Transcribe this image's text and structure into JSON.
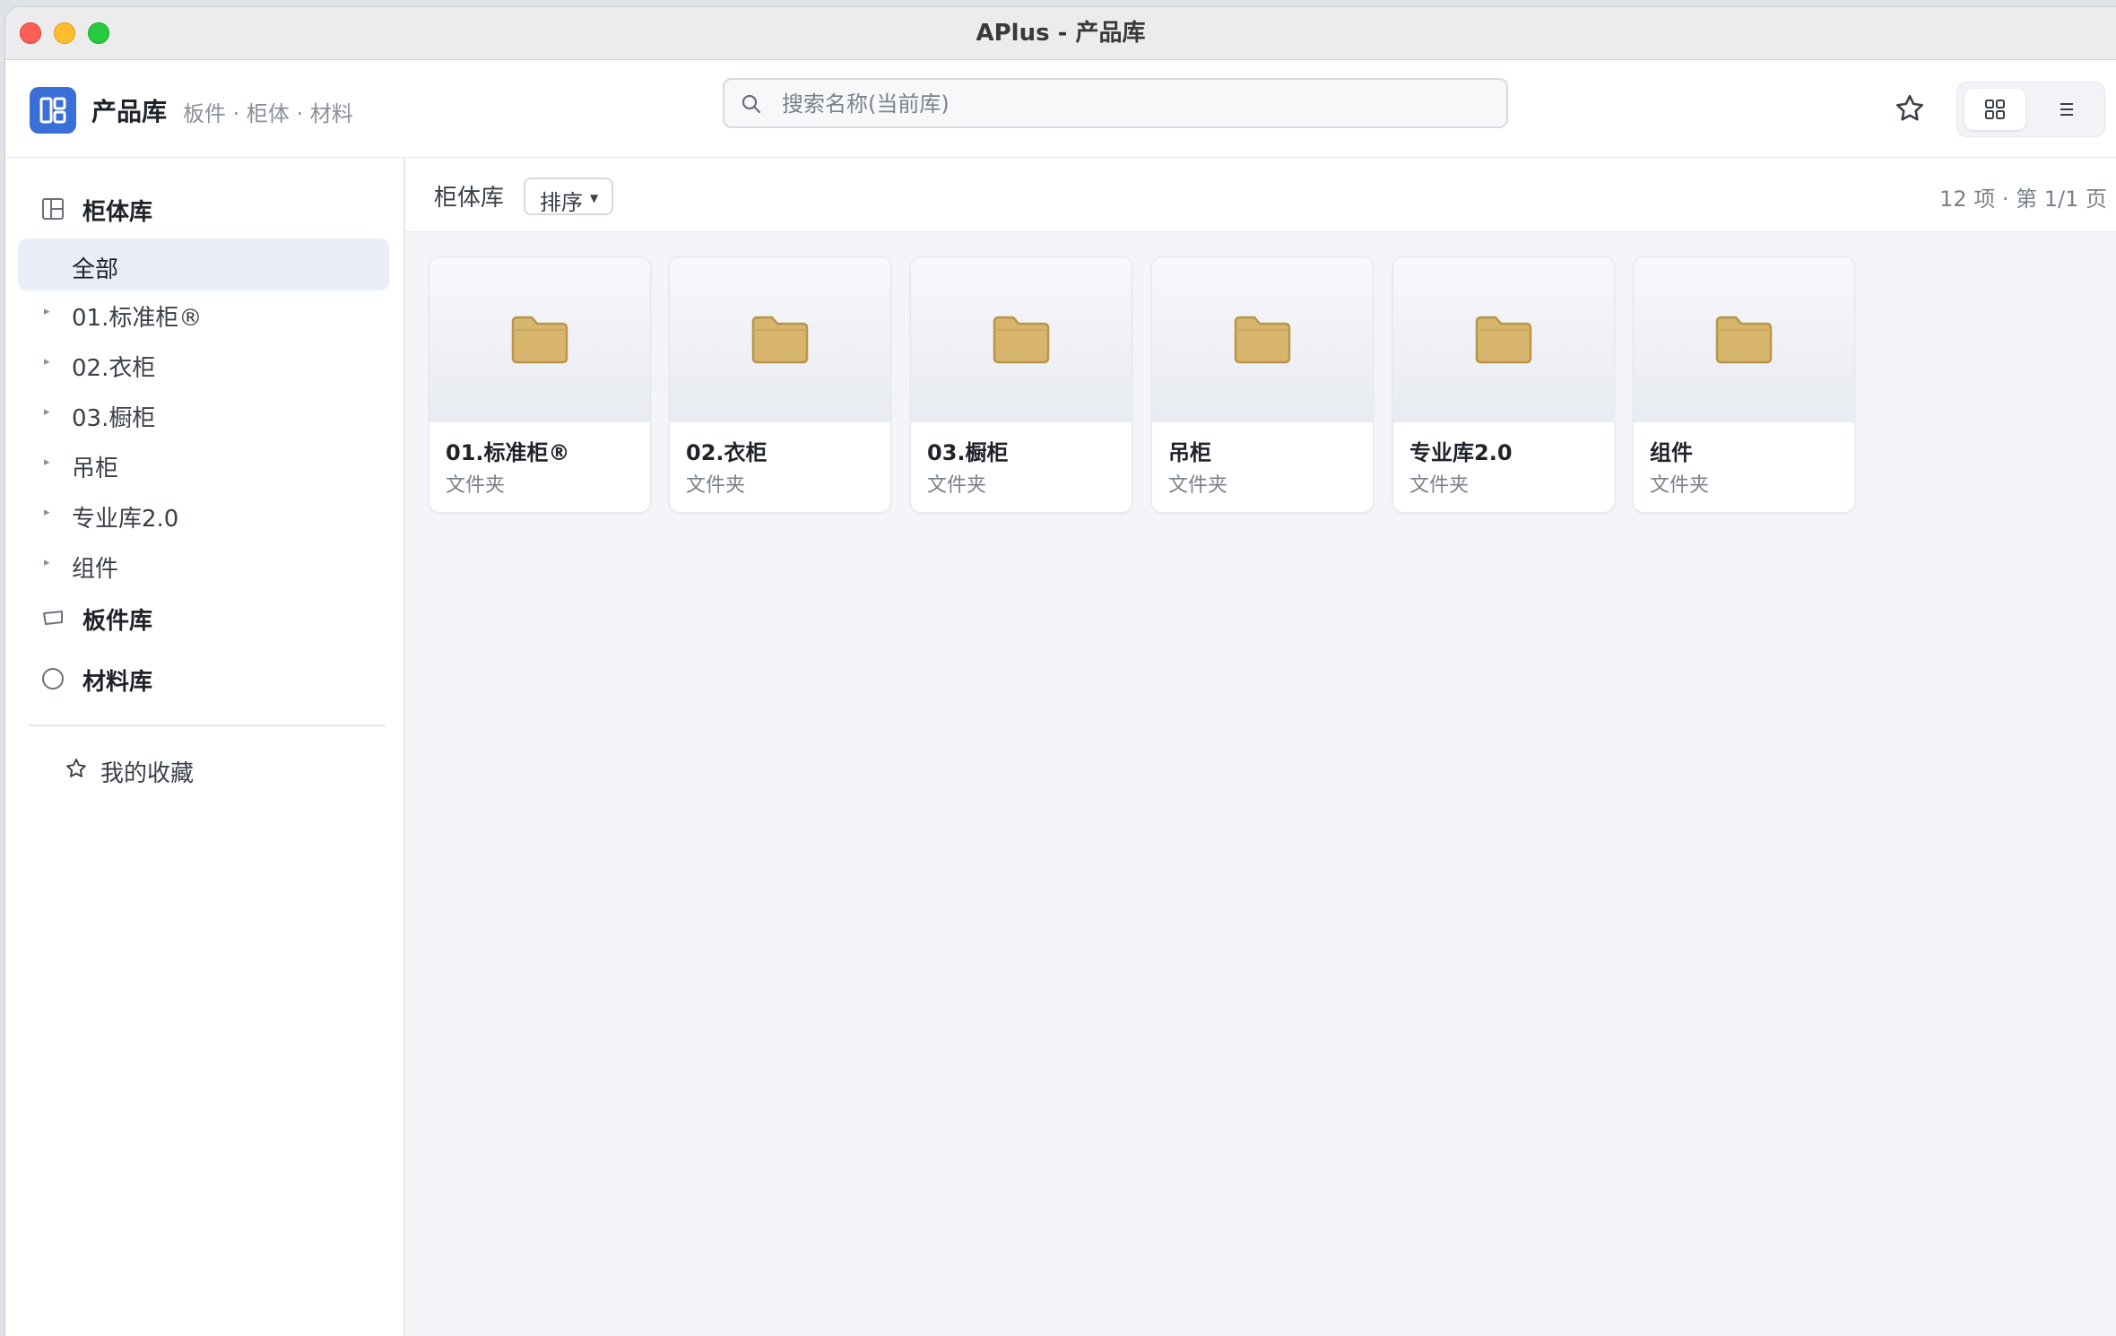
{
  "window": {
    "title": "APlus - 产品库"
  },
  "header": {
    "app_name": "产品库",
    "subtitle": "板件 · 柜体 · 材料",
    "search_placeholder": "搜索名称(当前库)",
    "icons": {
      "logo": "library-logo-icon",
      "favorite": "star-icon",
      "grid_view": "grid-view-icon",
      "list_view": "list-view-icon"
    }
  },
  "sidebar": {
    "cabinet_library": "柜体库",
    "all_label": "全部",
    "tree": [
      "01.标准柜®",
      "02.衣柜",
      "03.橱柜",
      "吊柜",
      "专业库2.0",
      "组件"
    ],
    "panel_library": "板件库",
    "material_library": "材料库",
    "favorites": "我的收藏"
  },
  "toolbar": {
    "title": "柜体库",
    "sort_label": "排序",
    "count_text": "12 项 · 第 1/1 页"
  },
  "items": [
    {
      "name": "01.标准柜®",
      "kind": "文件夹"
    },
    {
      "name": "02.衣柜",
      "kind": "文件夹"
    },
    {
      "name": "03.橱柜",
      "kind": "文件夹"
    },
    {
      "name": "吊柜",
      "kind": "文件夹"
    },
    {
      "name": "专业库2.0",
      "kind": "文件夹"
    },
    {
      "name": "组件",
      "kind": "文件夹"
    }
  ],
  "colors": {
    "accent": "#3b6fd8",
    "folder": "#d7b56d",
    "folder_stroke": "#b89548",
    "selected_bg": "#e9eef9"
  }
}
